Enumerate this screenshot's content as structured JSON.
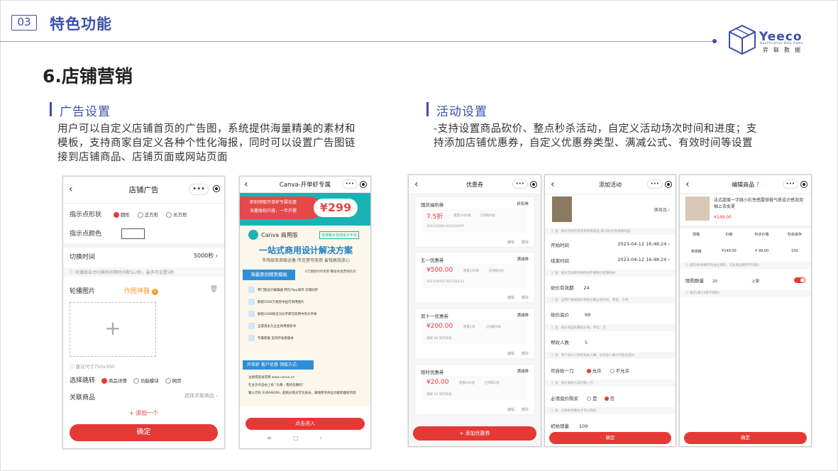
{
  "header": {
    "section_no": "03",
    "section_title": "特色功能",
    "logo": "Yeeco",
    "logo_sub": "Qualification Data Game",
    "logo_cn": "弈联数据"
  },
  "main_title": "6.店铺营销",
  "ad": {
    "heading": "广告设置",
    "desc_l1": "用户可以自定义店铺首页的广告图，系统提供海量精美的素材和",
    "desc_l2": "模板，支持商家自定义各种个性化海报，同时可以设置广告图链",
    "desc_l3": "接到店铺商品、店铺页面或网站页面"
  },
  "act": {
    "heading": "活动设置",
    "desc_l1": "-支持设置商品砍价、整点秒杀活动，自定义活动场次时间和进度；支",
    "desc_l2": "持添加店铺优惠券，自定义优惠券类型、满减公式、有效时间等设置"
  },
  "p1": {
    "title": "店铺广告",
    "shape_label": "指示点形状",
    "shape_opts": [
      "圆形",
      "正方形",
      "长方形"
    ],
    "color_label": "指示点颜色",
    "switch_label": "切换时间",
    "switch_val": "5000秒 ›",
    "switch_note": "轮播图自动切换的间隔时间默认2秒，最多可设置5秒",
    "carousel_label": "轮播图片",
    "poster_tool": "作图神器",
    "size_note": "建议尺寸750x300",
    "jump_label": "选择跳转",
    "jump_opts": [
      "商品详情",
      "功能模块",
      "网页"
    ],
    "related_label": "关联商品",
    "related_val": "选择关联商品 ›",
    "add_one": "+ 添加一个",
    "confirm": "确定"
  },
  "p2": {
    "title": "Canva-开单虾专属",
    "banner1": "即刻领取开单虾专属优惠",
    "banner2": "海量版权内容，一年只需",
    "price": "¥299",
    "brand": "Canva 商用版",
    "brand_tag": "全球最大在线设计平台",
    "headline": "一站式商用设计解决方案",
    "subline": "市场部及商家必备 所见皆可商用 省钱高效放心",
    "tpl_title": "海量原创精美模板",
    "tpl_note": "6万模板时时更新 覆盖各类营销热点",
    "features": [
      "零门槛设计编辑器 网页/App操作 云端同步",
      "解锁5000万视觉中国可商用图片",
      "解锁1000款含汉仪字库可商用中英文字体",
      "全渠道永久企业商用授权书",
      "专属客服 支持开发者版本"
    ],
    "claim_title": "开单虾 客户优惠 领取方式:",
    "steps": [
      "注册或登录官网 www.canva.cn",
      "在主页点击右上角 \"头像 › 我的优惠码\"",
      "输入代码 XURAN299，超低价购买年包会员，解锁所有商业功能和版权内容"
    ],
    "enter": "点击进入"
  },
  "p3": {
    "title": "优惠券",
    "coupons": [
      {
        "name": "国庆福利券",
        "type": "折扣券",
        "big": "7.5折",
        "limit": "限量1000张",
        "used": "已领取0张",
        "date": "2023/10/03-2023/10/07"
      },
      {
        "name": "五一优惠券",
        "type": "满减券",
        "big": "¥500.00",
        "limit": "限量200张",
        "used": "已领取0张",
        "date": "2023/04/03-2023/04/12"
      },
      {
        "name": "双十一优惠券",
        "type": "满减券",
        "big": "¥200.00",
        "limit": "限量2张",
        "used": "已领取0张",
        "date": "领取 30 天内有效"
      },
      {
        "name": "限时优惠券",
        "type": "满减券",
        "big": "¥20.00",
        "limit": "限量100张",
        "used": "已领取1张",
        "date": "领取 10 天内有效"
      }
    ],
    "edit": "编辑",
    "del": "删除",
    "add": "+ 添加优惠券"
  },
  "p4": {
    "title": "添加活动",
    "change": "换商品 ›",
    "note1": "注：砍价活动仅支持单规格商品 或 同价的多规格商品",
    "start_l": "开始时间",
    "start_v": "2023-04-12 16:48:24 ›",
    "end_l": "结束时间",
    "end_v": "2023-04-12 16:48:24 ›",
    "note2": "注：砍价活动的开始时间不能晚于结束时间",
    "valid_l": "砍价有效期",
    "valid_v": "24",
    "note3": "注：自用户发起砍价到砍价截止的时间，单位：小时",
    "floor_l": "砍价底价",
    "floor_v": "99",
    "note4": "注：砍价商品的最低价格，单位：元",
    "help_l": "帮砍人数",
    "help_v": "5",
    "note5": "注：每个砍价订单的帮砍人数，达到该人数才可砍至底价",
    "self_l": "可自砍一刀",
    "self_opts": [
      "允许",
      "不允许"
    ],
    "note6": "注：砍价发起人自己砍一刀",
    "must_l": "必须底价购买",
    "must_opts": [
      "是",
      "否"
    ],
    "note7": "注：只有砍到底价才可以购买",
    "init_l": "初始销量",
    "init_v": "109",
    "confirm": "确定"
  },
  "p5": {
    "title": "编辑商品",
    "goods": "法式甜美一字肩小衫性感露锁骨气质设计感泡泡袖上衣女夏",
    "goods_price": "¥149.00",
    "cols": [
      "规格",
      "价格",
      "秒杀价格",
      "秒杀库存"
    ],
    "row": [
      "单规格",
      "¥149.00",
      "¥ 99.00",
      "100"
    ],
    "note1": "提示(秒杀库存为独立库存，与主商品库存不同步)",
    "limit_l": "限购数量",
    "limit_v": "20",
    "shelf_l": "上架",
    "note2": "提示(填写0则不限购)",
    "confirm": "确定"
  }
}
